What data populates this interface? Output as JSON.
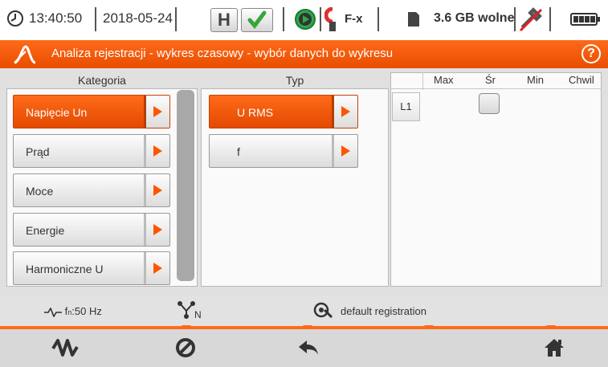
{
  "status": {
    "time": "13:40:50",
    "date": "2018-05-24",
    "hold_label": "H",
    "clamp_label": "F-x",
    "storage": "3.6 GB wolne"
  },
  "title": {
    "text": "Analiza rejestracji - wykres czasowy - wybór danych do wykresu",
    "help_label": "?"
  },
  "kategoria": {
    "header": "Kategoria",
    "items": [
      "Napięcie Un",
      "Prąd",
      "Moce",
      "Energie",
      "Harmoniczne U"
    ],
    "selected": "Napięcie Un"
  },
  "typ": {
    "header": "Typ",
    "items": [
      "U RMS",
      "f"
    ],
    "selected": "U RMS"
  },
  "table": {
    "columns": [
      "Max",
      "Śr",
      "Min",
      "Chwil"
    ],
    "rows": [
      {
        "label": "L1",
        "checked": []
      }
    ]
  },
  "info": {
    "frequency": "f",
    "frequency_sub": "n",
    "frequency_value": ":50 Hz",
    "network_sub": "N",
    "registration": "default registration"
  },
  "colors": {
    "accent": "#ff5500",
    "accent_dark": "#e34a00"
  },
  "icons": [
    "clock-icon",
    "hold-icon",
    "check-icon",
    "play-icon",
    "clamp-icon",
    "sd-card-icon",
    "usb-icon",
    "battery-icon",
    "logo-icon",
    "help-icon",
    "frequency-icon",
    "network-icon",
    "registration-icon",
    "waveform-icon",
    "cancel-icon",
    "back-icon",
    "home-icon"
  ]
}
